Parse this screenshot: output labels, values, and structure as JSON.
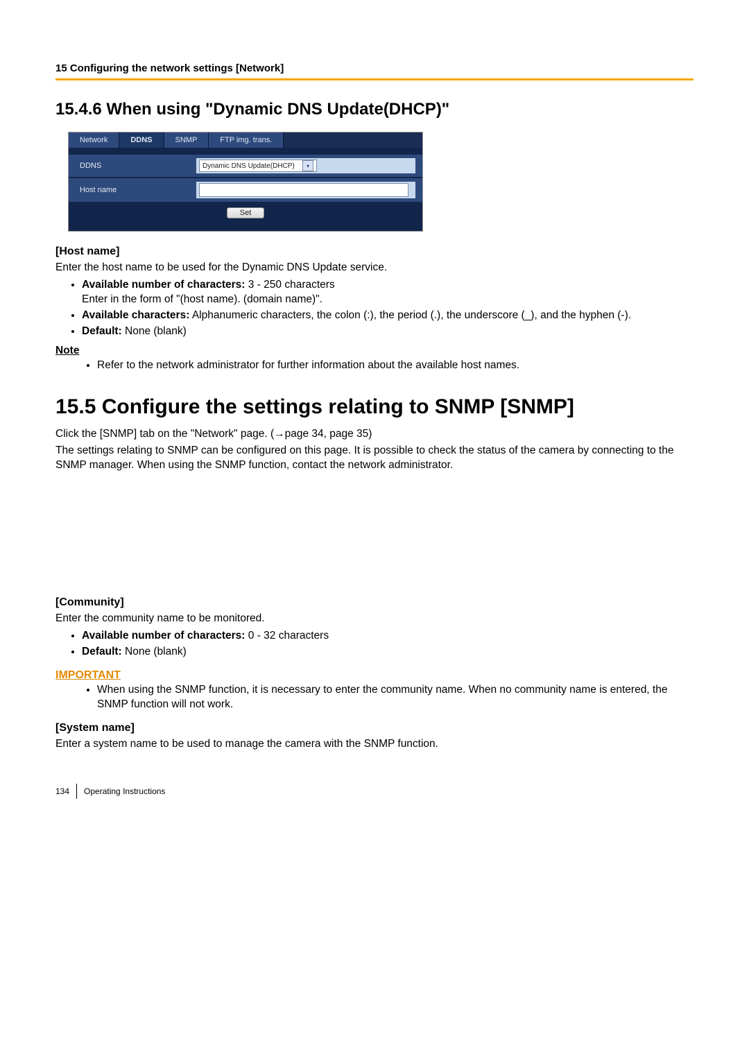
{
  "chapter_head": "15 Configuring the network settings [Network]",
  "sec1_title": "15.4.6  When using \"Dynamic DNS Update(DHCP)\"",
  "screenshot": {
    "tabs": {
      "network": "Network",
      "ddns": "DDNS",
      "snmp": "SNMP",
      "ftp": "FTP img. trans."
    },
    "row_ddns_label": "DDNS",
    "row_ddns_value": "Dynamic DNS Update(DHCP)",
    "row_host_label": "Host name",
    "set_button": "Set"
  },
  "hostname": {
    "heading": "[Host name]",
    "desc": "Enter the host name to be used for the Dynamic DNS Update service.",
    "b1_label": "Available number of characters:",
    "b1_rest": " 3 - 250 characters",
    "b1_line2": "Enter in the form of \"(host name). (domain name)\".",
    "b2_label": "Available characters:",
    "b2_rest": " Alphanumeric characters, the colon (:), the period (.), the underscore (_), and the hyphen (-).",
    "b3_label": "Default:",
    "b3_rest": " None (blank)",
    "note_head": "Note",
    "note_item": "Refer to the network administrator for further information about the available host names."
  },
  "sec2_title": "15.5  Configure the settings relating to SNMP [SNMP]",
  "sec2_p1_a": "Click the [SNMP] tab on the \"Network\" page. (",
  "sec2_p1_b": "page 34, page 35)",
  "sec2_p2": "The settings relating to SNMP can be configured on this page. It is possible to check the status of the camera by connecting to the SNMP manager. When using the SNMP function, contact the network administrator.",
  "community": {
    "heading": "[Community]",
    "desc": "Enter the community name to be monitored.",
    "b1_label": "Available number of characters:",
    "b1_rest": " 0 - 32 characters",
    "b2_label": "Default:",
    "b2_rest": " None (blank)"
  },
  "important": {
    "head": "IMPORTANT",
    "item": "When using the SNMP function, it is necessary to enter the community name. When no community name is entered, the SNMP function will not work."
  },
  "systemname": {
    "heading": "[System name]",
    "desc": "Enter a system name to be used to manage the camera with the SNMP function."
  },
  "footer": {
    "page": "134",
    "title": "Operating Instructions"
  }
}
